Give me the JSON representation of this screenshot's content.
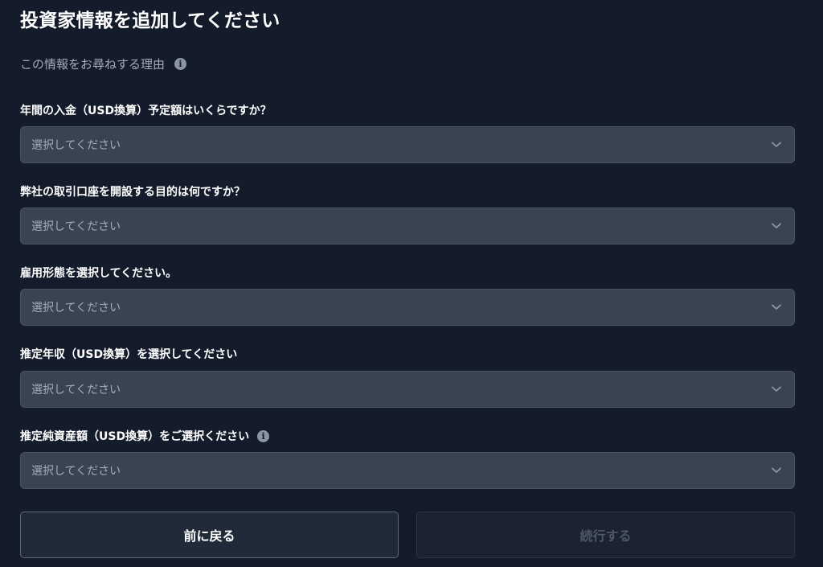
{
  "header": {
    "title": "投資家情報を追加してください",
    "why_text": "この情報をお尋ねする理由",
    "info_icon": "i"
  },
  "fields": [
    {
      "label": "年間の入金（USD換算）予定額はいくらですか？",
      "placeholder": "選択してください"
    },
    {
      "label": "弊社の取引口座を開設する目的は何ですか？",
      "placeholder": "選択してください"
    },
    {
      "label": "雇用形態を選択してください。",
      "placeholder": "選択してください"
    },
    {
      "label": "推定年収（USD換算）を選択してください",
      "placeholder": "選択してください"
    },
    {
      "label": "推定純資産額（USD換算）をご選択ください",
      "placeholder": "選択してください",
      "info_icon": "i"
    }
  ],
  "buttons": {
    "back_label": "前に戻る",
    "continue_label": "続行する"
  },
  "colors": {
    "background": "#141c2b",
    "select_background": "#394352",
    "disabled_text": "#4e5765"
  }
}
